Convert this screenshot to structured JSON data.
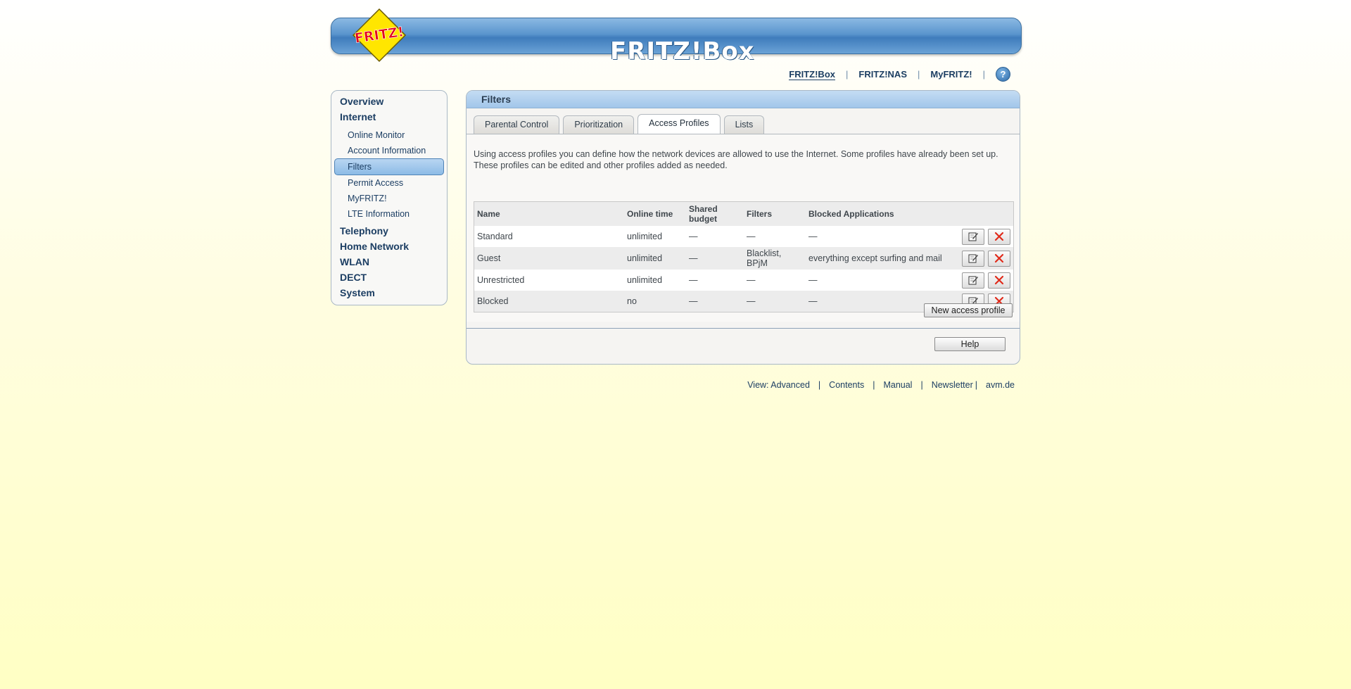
{
  "header": {
    "logo_text": "FRITZ!",
    "brand_text": "FRITZ!Box"
  },
  "topnav": {
    "items": [
      "FRITZ!Box",
      "FRITZ!NAS",
      "MyFRITZ!"
    ],
    "help_symbol": "?"
  },
  "sidebar": {
    "items": [
      {
        "label": "Overview"
      },
      {
        "label": "Internet"
      },
      {
        "label": "Online Monitor"
      },
      {
        "label": "Account Information"
      },
      {
        "label": "Filters"
      },
      {
        "label": "Permit Access"
      },
      {
        "label": "MyFRITZ!"
      },
      {
        "label": "LTE Information"
      },
      {
        "label": "Telephony"
      },
      {
        "label": "Home Network"
      },
      {
        "label": "WLAN"
      },
      {
        "label": "DECT"
      },
      {
        "label": "System"
      }
    ]
  },
  "main": {
    "title": "Filters",
    "tabs": [
      "Parental Control",
      "Prioritization",
      "Access Profiles",
      "Lists"
    ],
    "intro": "Using access profiles you can define how the network devices are allowed to use the Internet. Some profiles have already been set up. These profiles can be edited and other profiles added as needed.",
    "table": {
      "headers": [
        "Name",
        "Online time",
        "Shared budget",
        "Filters",
        "Blocked Applications"
      ],
      "rows": [
        [
          "Standard",
          "unlimited",
          "—",
          "—",
          "—"
        ],
        [
          "Guest",
          "unlimited",
          "—",
          "Blacklist, BPjM",
          "everything except surfing and mail"
        ],
        [
          "Unrestricted",
          "unlimited",
          "—",
          "—",
          "—"
        ],
        [
          "Blocked",
          "no",
          "—",
          "—",
          "—"
        ]
      ]
    },
    "new_profile_label": "New access profile",
    "help_label": "Help"
  },
  "footer": {
    "items": [
      "View: Advanced",
      "Contents",
      "Manual",
      "Newsletter",
      "avm.de"
    ]
  },
  "colors": {
    "accent_blue": "#1c3e63",
    "delete_red": "#e02a1a",
    "logo_yellow": "#ffe600",
    "logo_red": "#e3001b"
  }
}
